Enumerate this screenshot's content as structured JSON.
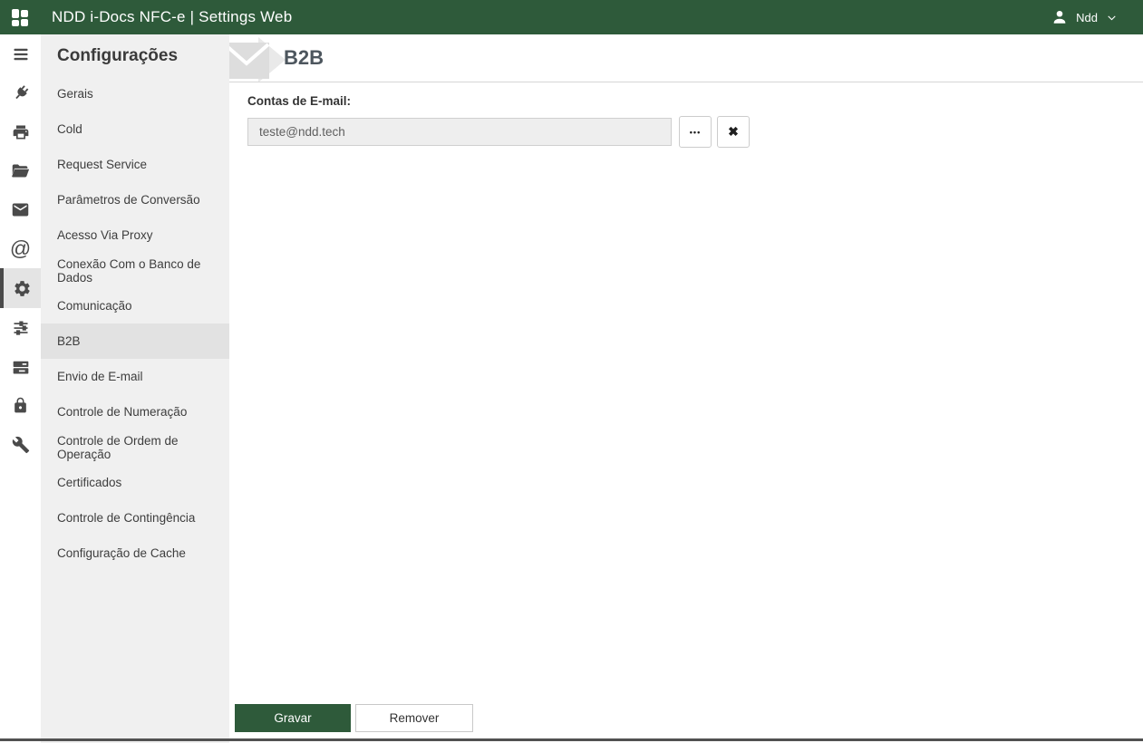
{
  "topbar": {
    "title": "NDD i-Docs NFC-e | Settings Web",
    "user": {
      "name": "Ndd"
    }
  },
  "icon_rail": {
    "items": [
      {
        "icon": "bars-icon",
        "active": false
      },
      {
        "icon": "plug-icon",
        "active": false
      },
      {
        "icon": "printer-icon",
        "active": false
      },
      {
        "icon": "folder-open-icon",
        "active": false
      },
      {
        "icon": "envelope-icon",
        "active": false
      },
      {
        "icon": "at-icon",
        "active": false,
        "glyph": "@"
      },
      {
        "icon": "gear-icon",
        "active": true
      },
      {
        "icon": "sliders-icon",
        "active": false
      },
      {
        "icon": "server-icon",
        "active": false
      },
      {
        "icon": "lock-icon",
        "active": false
      },
      {
        "icon": "wrench-icon",
        "active": false
      }
    ]
  },
  "sidebar": {
    "title": "Configurações",
    "items": [
      {
        "label": "Gerais",
        "selected": false
      },
      {
        "label": "Cold",
        "selected": false
      },
      {
        "label": "Request Service",
        "selected": false
      },
      {
        "label": "Parâmetros de Conversão",
        "selected": false
      },
      {
        "label": "Acesso Via Proxy",
        "selected": false
      },
      {
        "label": "Conexão Com o Banco de Dados",
        "selected": false
      },
      {
        "label": "Comunicação",
        "selected": false
      },
      {
        "label": "B2B",
        "selected": true
      },
      {
        "label": "Envio de E-mail",
        "selected": false
      },
      {
        "label": "Controle de Numeração",
        "selected": false
      },
      {
        "label": "Controle de Ordem de Operação",
        "selected": false
      },
      {
        "label": "Certificados",
        "selected": false
      },
      {
        "label": "Controle de Contingência",
        "selected": false
      },
      {
        "label": "Configuração de Cache",
        "selected": false
      }
    ]
  },
  "main": {
    "page_title": "B2B",
    "header_icon": "envelope-arrow-icon",
    "form": {
      "label": "Contas de E-mail:",
      "email_value": "teste@ndd.tech",
      "browse_label": "•••",
      "clear_label": "✖"
    },
    "actions": {
      "save_label": "Gravar",
      "remove_label": "Remover"
    }
  },
  "colors": {
    "brand_green": "#2e5a3a",
    "panel_gray": "#f0f0f0",
    "selected_gray": "#e2e2e2",
    "input_gray": "#eeeeee",
    "icon_gray": "#4a4a4a"
  }
}
